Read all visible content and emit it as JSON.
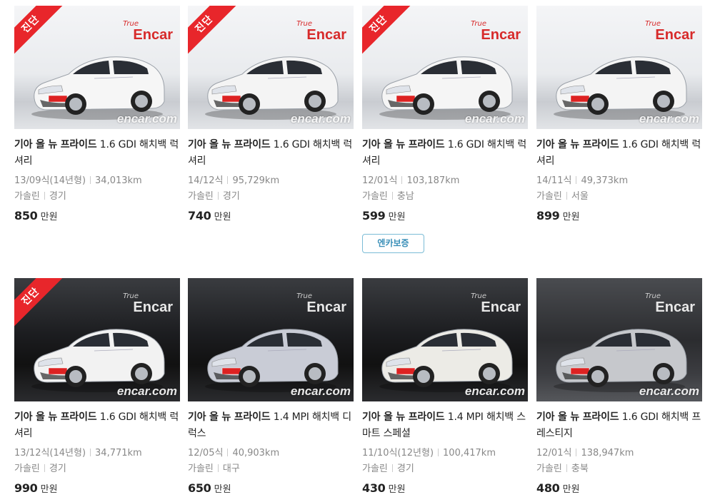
{
  "watermark": "encar.com",
  "logo_text": "Encar",
  "logo_small": "True",
  "ribbon_text": "진단",
  "price_unit": "만원",
  "listings": [
    {
      "brand": "기아 올 뉴 프라이드",
      "trim": "1.6 GDI 해치백 럭셔리",
      "year": "13/09식(14년형)",
      "mileage": "34,013km",
      "fuel": "가솔린",
      "region": "경기",
      "price": "850",
      "diagnosed": true
    },
    {
      "brand": "기아 올 뉴 프라이드",
      "trim": "1.6 GDI 해치백 럭셔리",
      "year": "14/12식",
      "mileage": "95,729km",
      "fuel": "가솔린",
      "region": "경기",
      "price": "740",
      "diagnosed": true
    },
    {
      "brand": "기아 올 뉴 프라이드",
      "trim": "1.6 GDI 해치백 럭셔리",
      "year": "12/01식",
      "mileage": "103,187km",
      "fuel": "가솔린",
      "region": "충남",
      "price": "599",
      "diagnosed": true,
      "badge": "엔카보증"
    },
    {
      "brand": "기아 올 뉴 프라이드",
      "trim": "1.6 GDI 해치백 럭셔리",
      "year": "14/11식",
      "mileage": "49,373km",
      "fuel": "가솔린",
      "region": "서울",
      "price": "899",
      "diagnosed": false
    },
    {
      "brand": "기아 올 뉴 프라이드",
      "trim": "1.6 GDI 해치백 럭셔리",
      "year": "13/12식(14년형)",
      "mileage": "34,771km",
      "fuel": "가솔린",
      "region": "경기",
      "price": "990",
      "diagnosed": true
    },
    {
      "brand": "기아 올 뉴 프라이드",
      "trim": "1.4 MPI 해치백 디럭스",
      "year": "12/05식",
      "mileage": "40,903km",
      "fuel": "가솔린",
      "region": "대구",
      "price": "650",
      "diagnosed": false
    },
    {
      "brand": "기아 올 뉴 프라이드",
      "trim": "1.4 MPI 해치백 스마트 스페셜",
      "year": "11/10식(12년형)",
      "mileage": "100,417km",
      "fuel": "가솔린",
      "region": "경기",
      "price": "430",
      "diagnosed": false
    },
    {
      "brand": "기아 올 뉴 프라이드",
      "trim": "1.6 GDI 해치백 프레스티지",
      "year": "12/01식",
      "mileage": "138,947km",
      "fuel": "가솔린",
      "region": "충북",
      "price": "480",
      "diagnosed": false
    }
  ],
  "colors": {
    "ribbon": "#e8262b",
    "badge_border": "#7bbcd6",
    "badge_text": "#3a8fb8",
    "logo_red": "#d72a2a"
  }
}
